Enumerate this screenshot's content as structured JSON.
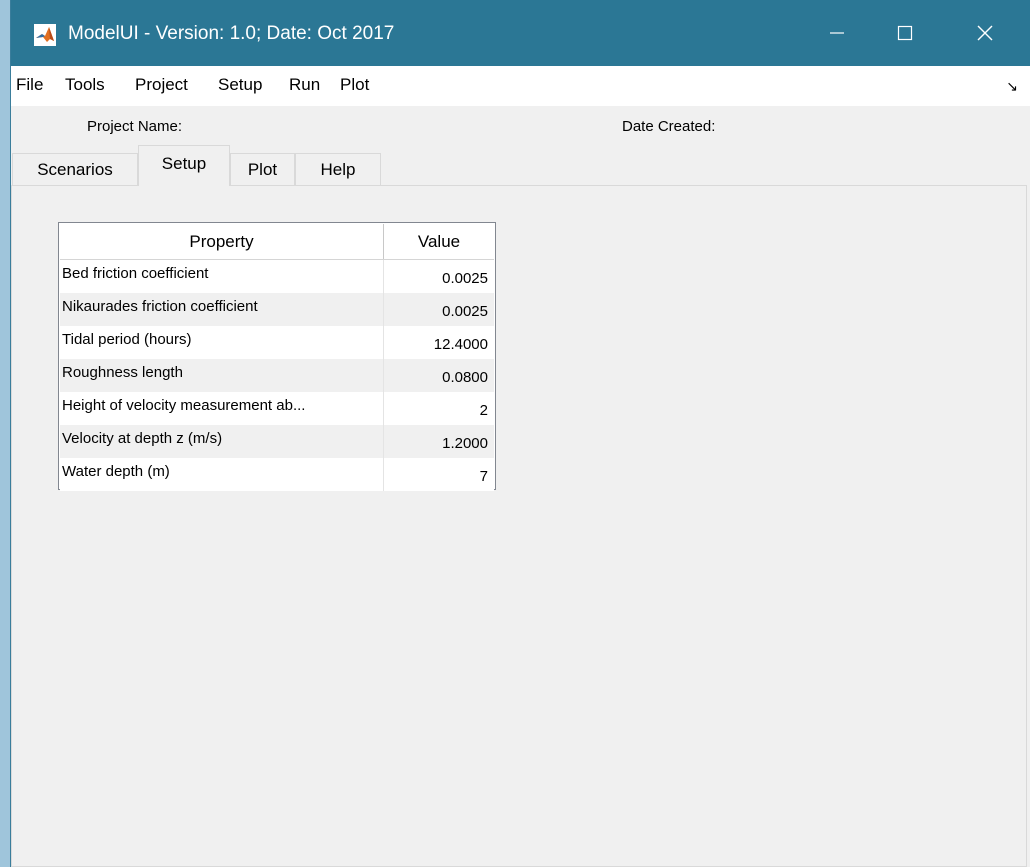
{
  "window": {
    "title": "ModelUI - Version: 1.0;  Date: Oct 2017",
    "icon": "matlab-logo-icon"
  },
  "window_controls": {
    "minimize_icon": "minimize-icon",
    "maximize_icon": "maximize-icon",
    "close_icon": "close-icon"
  },
  "menu": {
    "items": [
      "File",
      "Tools",
      "Project",
      "Setup",
      "Run",
      "Plot"
    ],
    "dock_arrow": "↘"
  },
  "project": {
    "name_label": "Project Name:",
    "date_label": "Date Created:"
  },
  "tabs": [
    {
      "label": "Scenarios",
      "active": false
    },
    {
      "label": "Setup",
      "active": true
    },
    {
      "label": "Plot",
      "active": false
    },
    {
      "label": "Help",
      "active": false
    }
  ],
  "property_table": {
    "headers": {
      "property": "Property",
      "value": "Value"
    },
    "rows": [
      {
        "property": "Bed friction coefficient",
        "value": "0.0025"
      },
      {
        "property": "Nikaurades friction coefficient",
        "value": "0.0025"
      },
      {
        "property": "Tidal period (hours)",
        "value": "12.4000"
      },
      {
        "property": "Roughness length",
        "value": "0.0800"
      },
      {
        "property": "Height of velocity measurement ab...",
        "value": "2"
      },
      {
        "property": "Velocity at depth z (m/s)",
        "value": "1.2000"
      },
      {
        "property": "Water depth (m)",
        "value": "7"
      }
    ]
  },
  "colors": {
    "titlebar": "#2b7795",
    "panel": "#f0f0f0",
    "menubar": "#ffffff"
  }
}
